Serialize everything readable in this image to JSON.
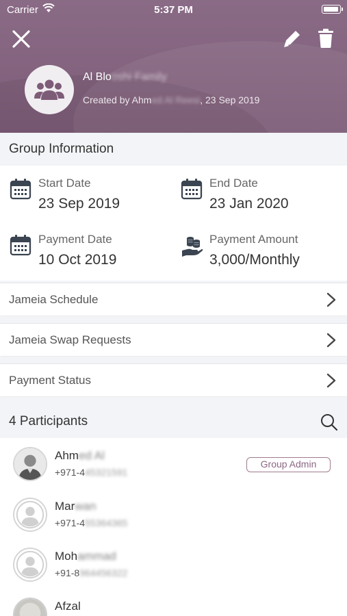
{
  "status_bar": {
    "carrier": "Carrier",
    "time": "5:37 PM"
  },
  "header": {
    "group_name": "Al Blo",
    "group_name_hidden": "oshi Family",
    "created_prefix": "Created by Ahm",
    "created_hidden": "ed Al Reesi",
    "created_suffix": ", 23 Sep 2019",
    "icons": {
      "close": "close-icon",
      "edit": "pencil-icon",
      "delete": "trash-icon",
      "group": "group-people-icon"
    }
  },
  "group_info": {
    "title": "Group Information",
    "start": {
      "label": "Start Date",
      "value": "23 Sep 2019",
      "icon": "calendar-icon"
    },
    "end": {
      "label": "End Date",
      "value": "23 Jan 2020",
      "icon": "calendar-icon"
    },
    "payment_date": {
      "label": "Payment Date",
      "value": "10 Oct 2019",
      "icon": "calendar-icon"
    },
    "payment_amount": {
      "label": "Payment Amount",
      "value": "3,000/Monthly",
      "icon": "coins-hand-icon"
    }
  },
  "menu": [
    {
      "label": "Jameia Schedule"
    },
    {
      "label": "Jameia Swap Requests"
    },
    {
      "label": "Payment Status"
    }
  ],
  "participants": {
    "title": "4 Participants",
    "badge_admin": "Group Admin",
    "list": [
      {
        "name": "Ahm",
        "name_hidden": "ed Al",
        "phone": "+971-4",
        "phone_hidden": "45321591",
        "admin": true,
        "avatar": "photo"
      },
      {
        "name": "Mar",
        "name_hidden": "wan",
        "phone": "+971-4",
        "phone_hidden": "55364365",
        "admin": false,
        "avatar": "placeholder"
      },
      {
        "name": "Moh",
        "name_hidden": "ammad",
        "phone": "+91-8",
        "phone_hidden": "964456322",
        "admin": false,
        "avatar": "placeholder"
      },
      {
        "name": "Afzal",
        "name_hidden": "",
        "phone": "",
        "phone_hidden": "",
        "admin": false,
        "avatar": "photo"
      }
    ]
  },
  "colors": {
    "header_bg": "#7d5c78",
    "accent": "#8b6882",
    "section_bg": "#f2f4f7"
  }
}
